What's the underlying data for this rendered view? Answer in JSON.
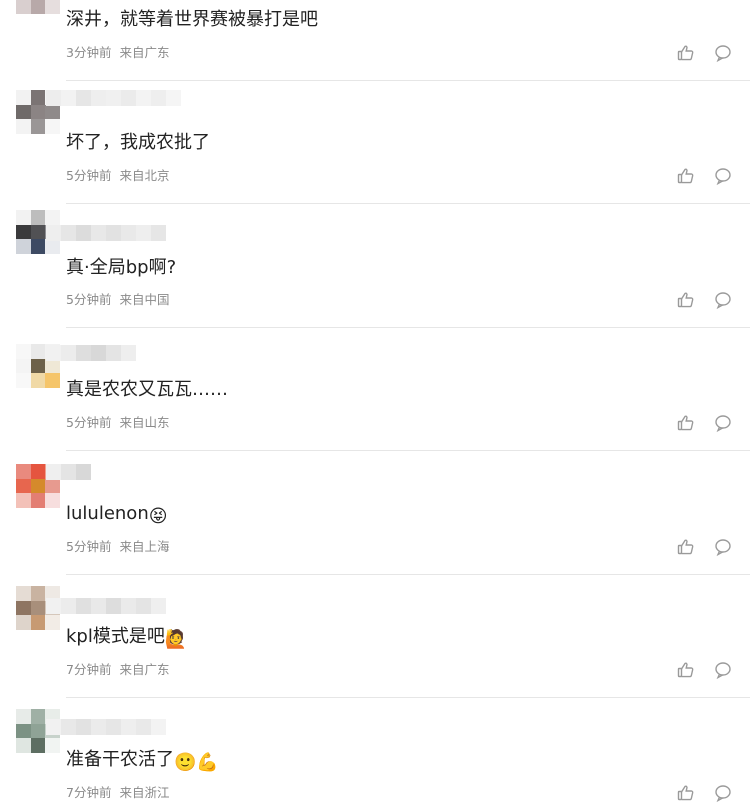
{
  "comments": [
    {
      "text": "深井，就等着世界赛被暴打是吧",
      "emoji": "",
      "time": "3分钟前",
      "location": "来自广东"
    },
    {
      "text": "坏了，我成农批了",
      "emoji": "",
      "time": "5分钟前",
      "location": "来自北京"
    },
    {
      "text": "真·全局bp啊?",
      "emoji": "",
      "time": "5分钟前",
      "location": "来自中国"
    },
    {
      "text": "真是农农又瓦瓦……",
      "emoji": "",
      "time": "5分钟前",
      "location": "来自山东"
    },
    {
      "text": "lululenon",
      "emoji": "😝",
      "time": "5分钟前",
      "location": "来自上海"
    },
    {
      "text": "kpl模式是吧",
      "emoji": "🙋",
      "time": "7分钟前",
      "location": "来自广东"
    },
    {
      "text": "准备干农活了",
      "emoji": "🙂💪",
      "time": "7分钟前",
      "location": "来自浙江"
    }
  ],
  "icons": {
    "like": "thumbs-up-icon",
    "reply": "comment-bubble-icon"
  },
  "colors": {
    "text": "#222222",
    "meta": "#8a8a8a",
    "divider": "#e6e6e6",
    "icon": "#9a9a9a"
  }
}
